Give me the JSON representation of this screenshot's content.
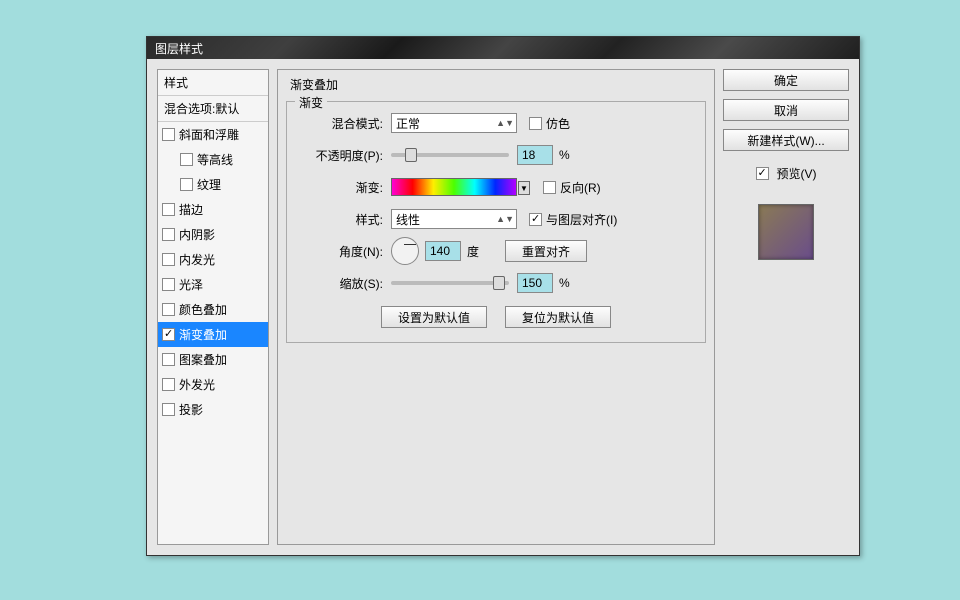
{
  "title": "图层样式",
  "sidebar": {
    "header1": "样式",
    "header2": "混合选项:默认",
    "items": [
      {
        "label": "斜面和浮雕",
        "checked": false,
        "indent": false
      },
      {
        "label": "等高线",
        "checked": false,
        "indent": true
      },
      {
        "label": "纹理",
        "checked": false,
        "indent": true
      },
      {
        "label": "描边",
        "checked": false,
        "indent": false
      },
      {
        "label": "内阴影",
        "checked": false,
        "indent": false
      },
      {
        "label": "内发光",
        "checked": false,
        "indent": false
      },
      {
        "label": "光泽",
        "checked": false,
        "indent": false
      },
      {
        "label": "颜色叠加",
        "checked": false,
        "indent": false
      },
      {
        "label": "渐变叠加",
        "checked": true,
        "indent": false,
        "selected": true
      },
      {
        "label": "图案叠加",
        "checked": false,
        "indent": false
      },
      {
        "label": "外发光",
        "checked": false,
        "indent": false
      },
      {
        "label": "投影",
        "checked": false,
        "indent": false
      }
    ]
  },
  "panel": {
    "group_title": "渐变叠加",
    "fieldset_title": "渐变",
    "blend_mode_label": "混合模式:",
    "blend_mode_value": "正常",
    "dither_label": "仿色",
    "opacity_label": "不透明度(P):",
    "opacity_value": "18",
    "percent": "%",
    "gradient_label": "渐变:",
    "reverse_label": "反向(R)",
    "style_label": "样式:",
    "style_value": "线性",
    "align_label": "与图层对齐(I)",
    "angle_label": "角度(N):",
    "angle_value": "140",
    "angle_unit": "度",
    "reset_align": "重置对齐",
    "scale_label": "缩放(S):",
    "scale_value": "150",
    "set_default": "设置为默认值",
    "reset_default": "复位为默认值"
  },
  "buttons": {
    "ok": "确定",
    "cancel": "取消",
    "new_style": "新建样式(W)...",
    "preview": "预览(V)"
  }
}
